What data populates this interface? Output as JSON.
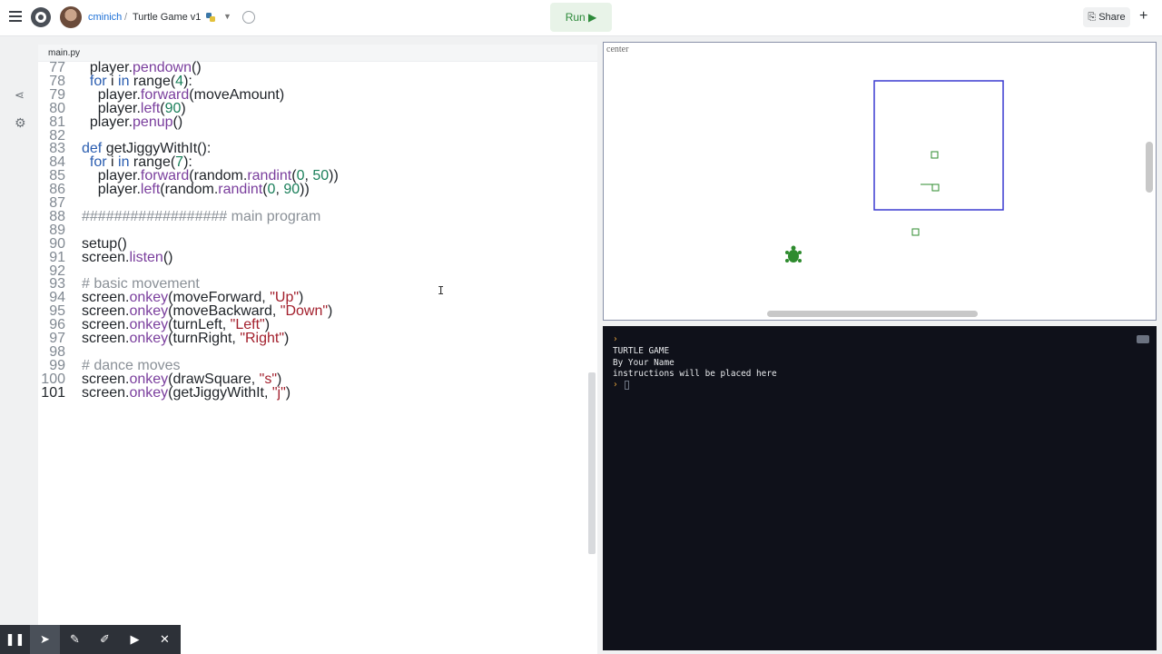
{
  "header": {
    "username": "cminich",
    "separator": "/",
    "project_title": "Turtle Game v1",
    "run_label": "Run ▶",
    "share_label": "Share"
  },
  "file_tab": {
    "name": "main.py"
  },
  "code_lines": [
    {
      "n": "77",
      "t": "  player.pendown()"
    },
    {
      "n": "78",
      "t": "  for i in range(4):"
    },
    {
      "n": "79",
      "t": "    player.forward(moveAmount)"
    },
    {
      "n": "80",
      "t": "    player.left(90)"
    },
    {
      "n": "81",
      "t": "  player.penup()"
    },
    {
      "n": "82",
      "t": ""
    },
    {
      "n": "83",
      "t": "def getJiggyWithIt():"
    },
    {
      "n": "84",
      "t": "  for i in range(7):"
    },
    {
      "n": "85",
      "t": "    player.forward(random.randint(0, 50))"
    },
    {
      "n": "86",
      "t": "    player.left(random.randint(0, 90))"
    },
    {
      "n": "87",
      "t": ""
    },
    {
      "n": "88",
      "t": "################## main program"
    },
    {
      "n": "89",
      "t": ""
    },
    {
      "n": "90",
      "t": "setup()"
    },
    {
      "n": "91",
      "t": "screen.listen()"
    },
    {
      "n": "92",
      "t": ""
    },
    {
      "n": "93",
      "t": "# basic movement"
    },
    {
      "n": "94",
      "t": "screen.onkey(moveForward, \"Up\")"
    },
    {
      "n": "95",
      "t": "screen.onkey(moveBackward, \"Down\")"
    },
    {
      "n": "96",
      "t": "screen.onkey(turnLeft, \"Left\")"
    },
    {
      "n": "97",
      "t": "screen.onkey(turnRight, \"Right\")"
    },
    {
      "n": "98",
      "t": ""
    },
    {
      "n": "99",
      "t": "# dance moves"
    },
    {
      "n": "100",
      "t": "screen.onkey(drawSquare, \"s\")"
    },
    {
      "n": "101",
      "t": "screen.onkey(getJiggyWithIt, \"j\")"
    }
  ],
  "canvas": {
    "label": "center"
  },
  "console": {
    "lines": [
      "TURTLE GAME",
      "By Your Name",
      "instructions will be placed here"
    ],
    "prompt": "›"
  },
  "colors": {
    "accent": "#1b6fd6",
    "run_green": "#2d8a3a",
    "turtle_green": "#2e8b2e",
    "square_blue": "#3a3ad0",
    "console_bg": "#0f111a"
  },
  "icons": [
    "menu-icon",
    "logo-icon",
    "python-icon",
    "chevron-down-icon",
    "history-icon",
    "share-icon",
    "plus-icon",
    "gear-icon",
    "pause-icon",
    "cursor-icon",
    "pencil-icon",
    "highlighter-icon",
    "camera-icon",
    "close-icon",
    "clear-console-icon"
  ]
}
